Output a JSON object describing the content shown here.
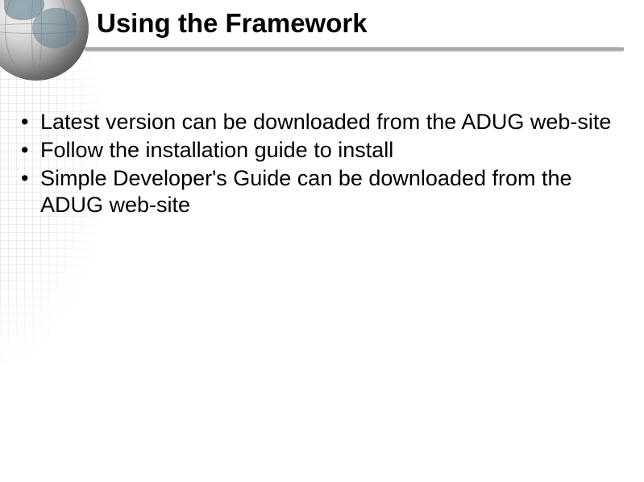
{
  "slide": {
    "title": "Using the Framework",
    "bullets": [
      "Latest version can be downloaded from the ADUG web-site",
      "Follow the installation guide to install",
      "Simple Developer's Guide can be downloaded from the ADUG web-site"
    ]
  }
}
